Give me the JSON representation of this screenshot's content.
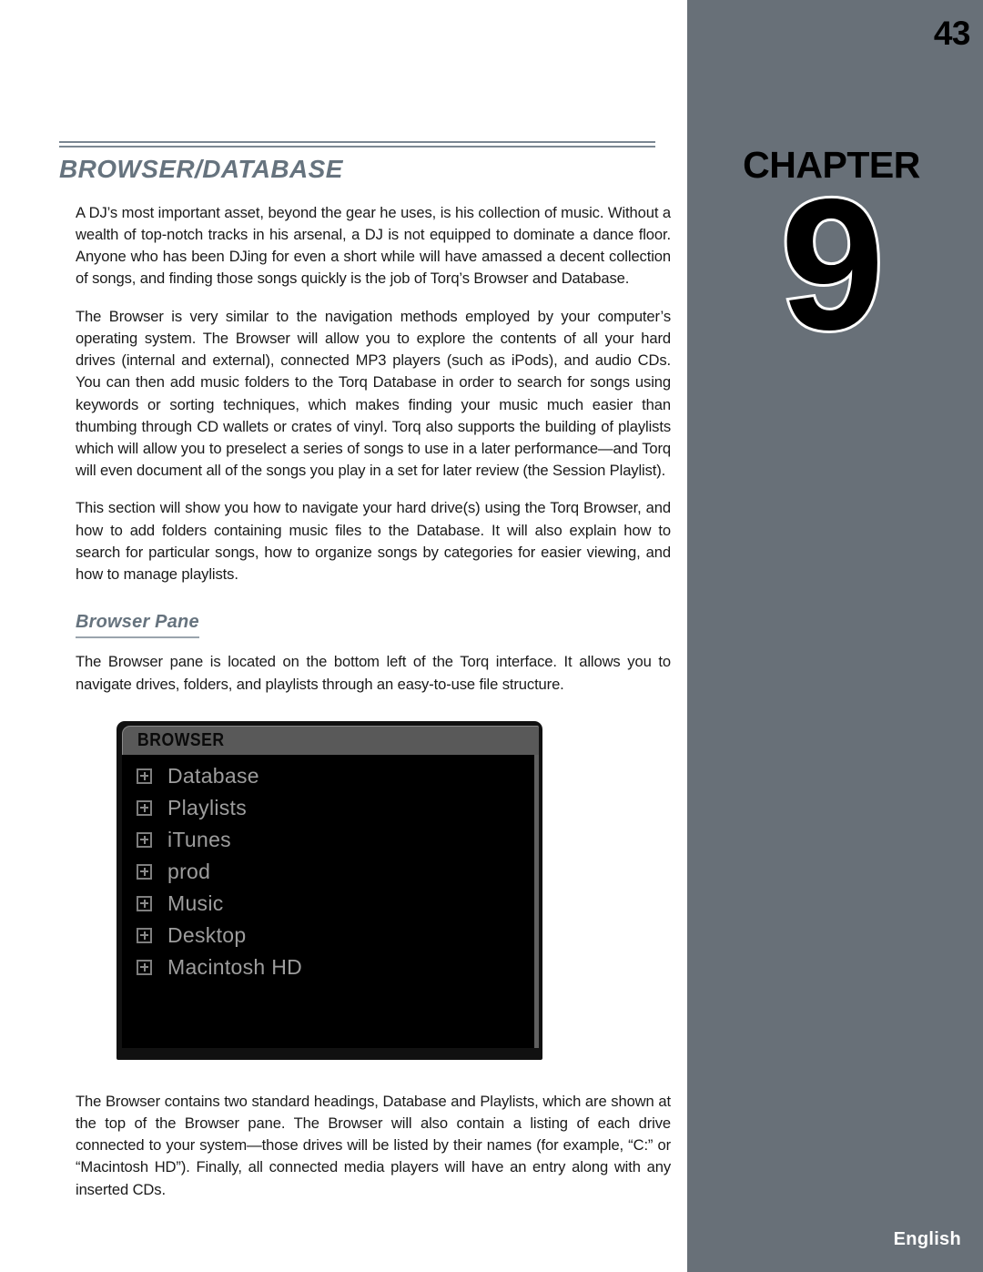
{
  "sidebar": {
    "page_number": "43",
    "chapter_word": "CHAPTER",
    "chapter_number": "9",
    "language": "English",
    "background_color": "#687078"
  },
  "document": {
    "section_title": "BROWSER/DATABASE",
    "title_accent_color": "#66737e",
    "paragraphs": [
      "A DJ’s most important asset, beyond the gear he uses, is his collection of music. Without a wealth of top-notch tracks in his arsenal, a DJ is not equipped to dominate a dance floor. Anyone who has been DJing for even a short while will have amassed a decent collection of songs, and finding those songs quickly is the job of Torq’s Browser and Database.",
      "The Browser is very similar to the navigation methods employed by your computer’s operating system. The Browser will allow you to explore the contents of all your hard drives (internal and external), connected MP3 players (such as iPods), and audio CDs. You can then add music folders to the Torq Database in order to search for songs using keywords or sorting techniques, which makes finding your music much easier than thumbing through CD wallets or crates of vinyl. Torq also supports the building of playlists which will allow you to preselect a series of songs to use in a later performance—and Torq will even document all of the songs you play in a set for later review (the Session Playlist).",
      "This section will show you how to navigate your hard drive(s) using the Torq Browser, and how to add folders containing music files to the Database. It will also explain how to search for particular songs, how to organize songs by categories for easier viewing, and how to manage playlists."
    ],
    "subsection_title": "Browser Pane",
    "subsection_intro": "The Browser pane is located on the bottom left of the Torq interface. It allows you to navigate drives, folders, and playlists through an easy-to-use file structure.",
    "closing_paragraph": "The Browser contains two standard headings, Database and Playlists, which are shown at the top of the Browser pane. The Browser will also contain a listing of each drive connected to your system—those drives will be listed by their names (for example, “C:” or “Macintosh HD”). Finally, all connected media players will have an entry along with any inserted CDs."
  },
  "browser_figure": {
    "panel_title": "BROWSER",
    "items": [
      {
        "label": "Database",
        "expander": "plus-icon"
      },
      {
        "label": "Playlists",
        "expander": "plus-icon"
      },
      {
        "label": "iTunes",
        "expander": "plus-icon"
      },
      {
        "label": "prod",
        "expander": "plus-icon"
      },
      {
        "label": "Music",
        "expander": "plus-icon"
      },
      {
        "label": "Desktop",
        "expander": "plus-icon"
      },
      {
        "label": "Macintosh HD",
        "expander": "plus-icon"
      }
    ]
  }
}
